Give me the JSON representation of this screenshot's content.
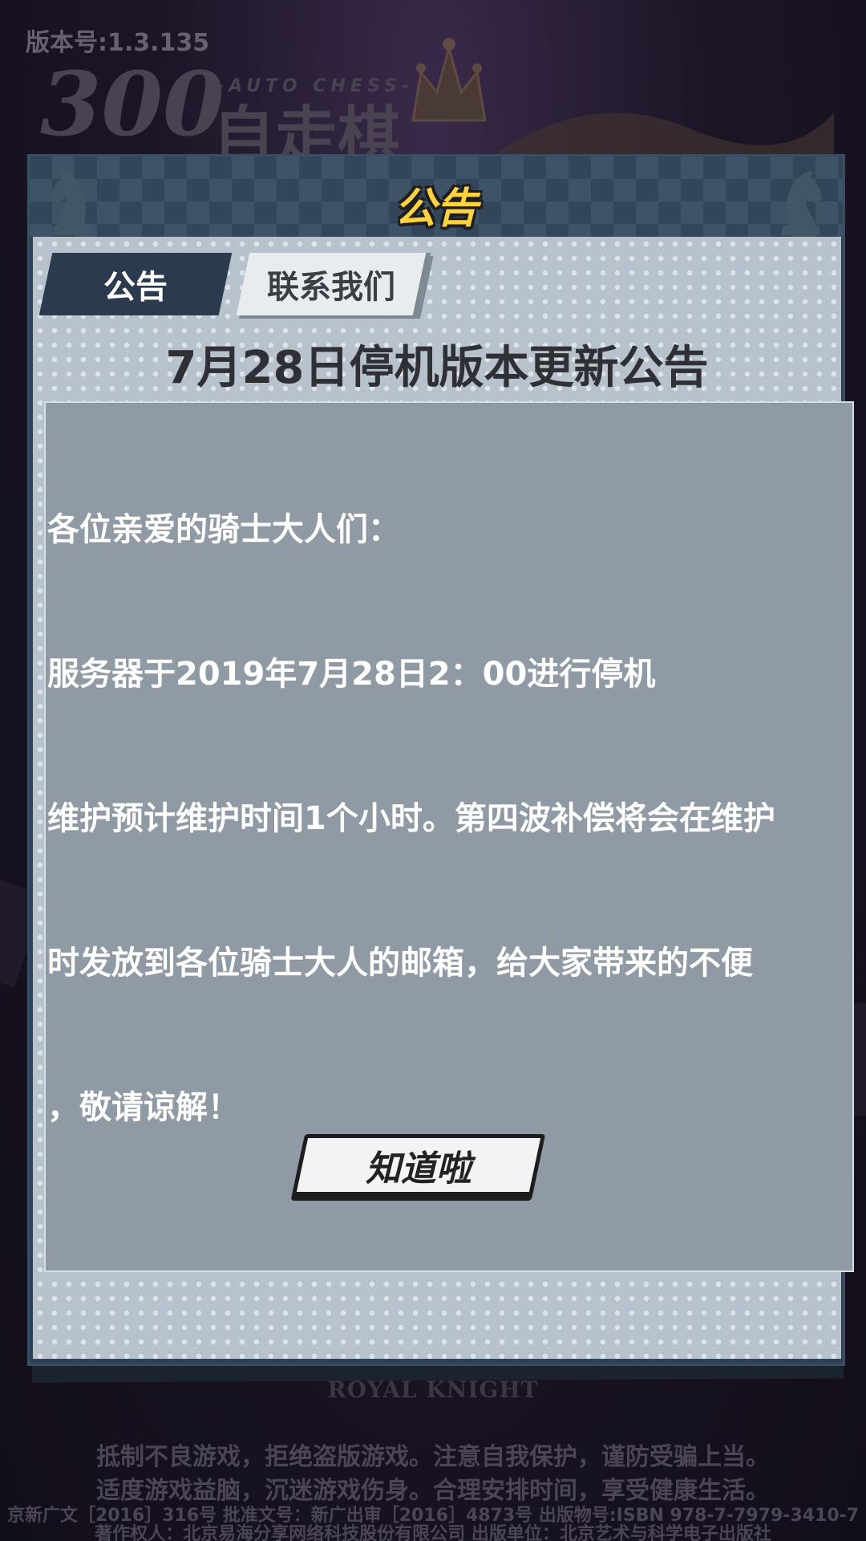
{
  "app": {
    "version": "版本号:1.3.135",
    "logo_number": "300",
    "logo_subtitle": "-AUTO CHESS-",
    "logo_title": "自走棋"
  },
  "dialog": {
    "title": "公告",
    "tabs": [
      {
        "label": "公告",
        "active": true
      },
      {
        "label": "联系我们",
        "active": false
      }
    ],
    "notice_title": "7月28日停机版本更新公告",
    "content_lines": [
      "各位亲爱的骑士大人们：",
      "服务器于2019年7月28日2：00进行停机",
      "维护预计维护时间1个小时。第四波补偿将会在维护",
      "时发放到各位骑士大人的邮箱，给大家带来的不便",
      "，敬请谅解！"
    ],
    "confirm_button": "知道啦"
  },
  "footer": {
    "brand": "ROYAL KNIGHT",
    "lines": [
      "抵制不良游戏，拒绝盗版游戏。注意自我保护，谨防受骗上当。",
      "适度游戏益脑，沉迷游戏伤身。合理安排时间，享受健康生活。",
      "京新广文［2016］316号  批准文号：新广出审［2016］4873号  出版物号:ISBN 978-7-7979-3410-7",
      "著作权人：北京易海分享网络科技股份有限公司  出版单位：北京艺术与科学电子出版社"
    ]
  },
  "colors": {
    "title_yellow": "#ffd23f",
    "tab_active_bg": "#2b3a4c",
    "tab_inactive_bg": "#e9ecef",
    "content_bg": "#8f9aa4",
    "panel_bg": "#b8c2cc",
    "header_bg": "#324559"
  },
  "icons": [
    "knight-chess-icon",
    "crown-icon"
  ]
}
